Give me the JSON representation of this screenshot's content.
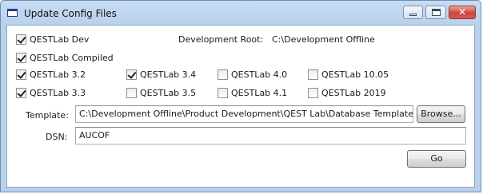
{
  "window": {
    "title": "Update Config Files",
    "controls": {
      "minimize": "minimize",
      "maximize": "maximize",
      "close": "✕"
    }
  },
  "checkboxes": {
    "dev": {
      "label": "QESTLab Dev",
      "checked": true
    },
    "compiled": {
      "label": "QESTLab Compiled",
      "checked": true
    },
    "v32": {
      "label": "QESTLab 3.2",
      "checked": true
    },
    "v33": {
      "label": "QESTLab 3.3",
      "checked": true
    },
    "v34": {
      "label": "QESTLab 3.4",
      "checked": true
    },
    "v35": {
      "label": "QESTLab 3.5",
      "checked": false
    },
    "v40": {
      "label": "QESTLab 4.0",
      "checked": false
    },
    "v41": {
      "label": "QESTLab 4.1",
      "checked": false
    },
    "v1005": {
      "label": "QESTLab 10.05",
      "checked": false
    },
    "v2019": {
      "label": "QESTLab 2019",
      "checked": false
    }
  },
  "dev_root": {
    "label": "Development Root:",
    "value": "C:\\Development Offline"
  },
  "template": {
    "label": "Template:",
    "value": "C:\\Development Offline\\Product Development\\QEST Lab\\Database Template",
    "browse_label": "Browse..."
  },
  "dsn": {
    "label": "DSN:",
    "value": "AUCOF"
  },
  "go_label": "Go",
  "colors": {
    "title_bar": "#b9d1ec",
    "close_button": "#c9463a",
    "border": "#6b8eb3"
  }
}
